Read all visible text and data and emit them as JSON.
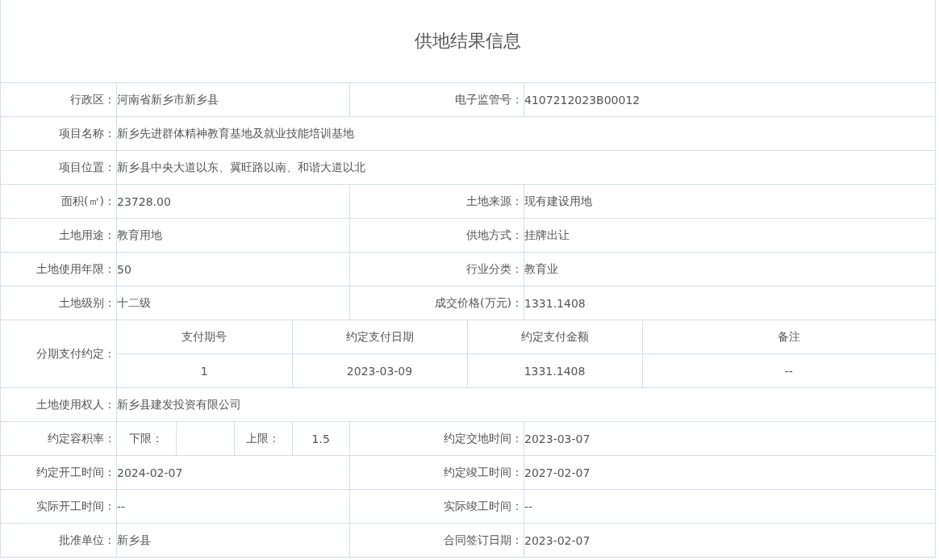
{
  "title": "供地结果信息",
  "rows": [
    {
      "kind": "pair",
      "fields": [
        {
          "label": "行政区：",
          "value": "河南省新乡市新乡县"
        },
        {
          "label": "电子监管号：",
          "value": "4107212023B00012"
        }
      ]
    },
    {
      "kind": "single",
      "fields": [
        {
          "label": "项目名称：",
          "value": "新乡先进群体精神教育基地及就业技能培训基地"
        }
      ]
    },
    {
      "kind": "single",
      "fields": [
        {
          "label": "项目位置：",
          "value": "新乡县中央大道以东、冀旺路以南、和谐大道以北"
        }
      ]
    },
    {
      "kind": "pair",
      "fields": [
        {
          "label": "面积(㎡)：",
          "value": "23728.00"
        },
        {
          "label": "土地来源：",
          "value": "现有建设用地"
        }
      ]
    },
    {
      "kind": "pair",
      "fields": [
        {
          "label": "土地用途：",
          "value": "教育用地"
        },
        {
          "label": "供地方式：",
          "value": "挂牌出让"
        }
      ]
    },
    {
      "kind": "pair",
      "fields": [
        {
          "label": "土地使用年限：",
          "value": "50"
        },
        {
          "label": "行业分类：",
          "value": "教育业"
        }
      ]
    },
    {
      "kind": "pair",
      "fields": [
        {
          "label": "土地级别：",
          "value": "十二级"
        },
        {
          "label": "成交价格(万元)：",
          "value": "1331.1408"
        }
      ]
    },
    {
      "kind": "installments",
      "label": "分期支付约定：",
      "columns": [
        "支付期号",
        "约定支付日期",
        "约定支付金额",
        "备注"
      ],
      "rows": [
        [
          "1",
          "2023-03-09",
          "1331.1408",
          "--"
        ]
      ]
    },
    {
      "kind": "single",
      "fields": [
        {
          "label": "土地使用权人：",
          "value": "新乡县建发投资有限公司"
        }
      ]
    },
    {
      "kind": "ratio",
      "label": "约定容积率：",
      "lower_label": "下限：",
      "upper_label": "上限：",
      "upper_value": "1.5",
      "fields": [
        {
          "label": "约定交地时间：",
          "value": "2023-03-07"
        }
      ]
    },
    {
      "kind": "pair",
      "fields": [
        {
          "label": "约定开工时间：",
          "value": "2024-02-07"
        },
        {
          "label": "约定竣工时间：",
          "value": "2027-02-07"
        }
      ]
    },
    {
      "kind": "pair",
      "fields": [
        {
          "label": "实际开工时间：",
          "value": "--"
        },
        {
          "label": "实际竣工时间：",
          "value": "--"
        }
      ]
    },
    {
      "kind": "pair",
      "fields": [
        {
          "label": "批准单位：",
          "value": "新乡县"
        },
        {
          "label": "合同签订日期：",
          "value": "2023-02-07"
        }
      ]
    }
  ]
}
